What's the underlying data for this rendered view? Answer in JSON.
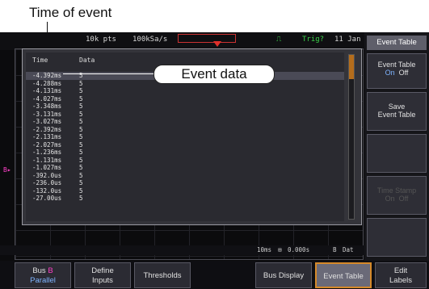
{
  "annotations": {
    "time_of_event": "Time of event",
    "event_data": "Event data"
  },
  "top_bar": {
    "record": "10k pts",
    "sample_rate": "100kSa/s",
    "trigger": "Trig?",
    "date": "11 Jan"
  },
  "event_table": {
    "headers": [
      "Time",
      "Data"
    ],
    "rows": [
      {
        "time": "-4.392ms",
        "data": "5"
      },
      {
        "time": "-4.288ms",
        "data": "5"
      },
      {
        "time": "-4.131ms",
        "data": "5"
      },
      {
        "time": "-4.027ms",
        "data": "5"
      },
      {
        "time": "-3.348ms",
        "data": "5"
      },
      {
        "time": "-3.131ms",
        "data": "5"
      },
      {
        "time": "-3.027ms",
        "data": "5"
      },
      {
        "time": "-2.392ms",
        "data": "5"
      },
      {
        "time": "-2.131ms",
        "data": "5"
      },
      {
        "time": "-2.027ms",
        "data": "5"
      },
      {
        "time": "-1.236ms",
        "data": "5"
      },
      {
        "time": "-1.131ms",
        "data": "5"
      },
      {
        "time": "-1.027ms",
        "data": "5"
      },
      {
        "time": "-392.0us",
        "data": "5"
      },
      {
        "time": "-236.0us",
        "data": "5"
      },
      {
        "time": "-132.0us",
        "data": "5"
      },
      {
        "time": "-27.00us",
        "data": "5"
      }
    ]
  },
  "status_bar": {
    "timebase": "10ms",
    "position": "0.000s",
    "bus": "B",
    "bus_label": "Dat"
  },
  "right_menu": {
    "title": "Event Table",
    "event_table_toggle": {
      "label": "Event Table",
      "on": "On",
      "off": "Off"
    },
    "save_line1": "Save",
    "save_line2": "Event Table",
    "disabled_line1": "Time Stamp",
    "disabled_on": "On",
    "disabled_off": "Off"
  },
  "bottom_menu": {
    "bus_line1": "Bus",
    "bus_badge": "B",
    "bus_line2": "Parallel",
    "define_line1": "Define",
    "define_line2": "Inputs",
    "thresholds": "Thresholds",
    "bus_display": "Bus Display",
    "event_table": "Event Table",
    "edit_line1": "Edit",
    "edit_line2": "Labels"
  },
  "colors": {
    "accent": "#d68a2a",
    "trigger_green": "#3bd24a",
    "bus_magenta": "#ff40c8",
    "on_blue": "#7fb4ff"
  }
}
